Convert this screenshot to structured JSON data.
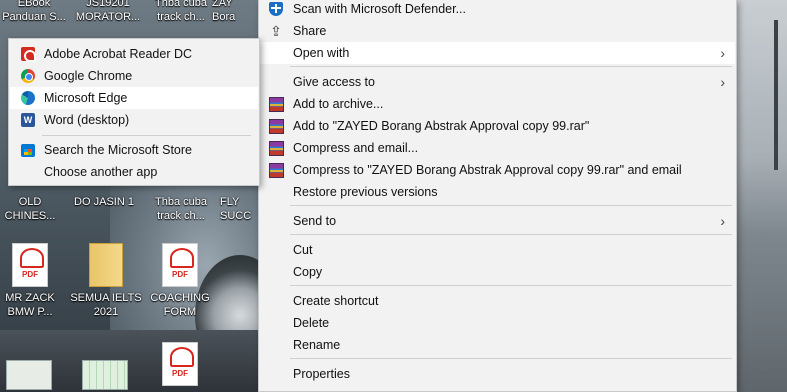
{
  "desktop": {
    "top_labels": [
      "EBook\nPanduan S...",
      "JS19201\nMORATOR...",
      "Thba cuba\ntrack ch...",
      "ZAY\nBora"
    ],
    "mid_labels": [
      "OLD\nCHINES...",
      "DO JASIN 1",
      "Thba cuba\ntrack ch...",
      "FLY\nSUCC"
    ],
    "icons": [
      {
        "label": "MR ZACK\nBMW P...",
        "type": "pdf"
      },
      {
        "label": "SEMUA IELTS\n2021",
        "type": "folder"
      },
      {
        "label": "COACHING\nFORM",
        "type": "pdf"
      },
      {
        "label": "",
        "type": "pdf"
      }
    ],
    "pdf_badge": "PDF"
  },
  "context_menu": {
    "items": [
      {
        "label": "Scan with Microsoft Defender...",
        "icon": "shield-icon"
      },
      {
        "label": "Share",
        "icon": "share-icon"
      },
      {
        "label": "Open with",
        "icon": "",
        "submenu": true,
        "highlighted": true
      },
      {
        "label": "Give access to",
        "icon": "",
        "submenu": true
      },
      {
        "label": "Add to archive...",
        "icon": "winrar-icon"
      },
      {
        "label": "Add to \"ZAYED Borang Abstrak Approval copy 99.rar\"",
        "icon": "winrar-icon"
      },
      {
        "label": "Compress and email...",
        "icon": "winrar-icon"
      },
      {
        "label": "Compress to \"ZAYED Borang Abstrak Approval copy 99.rar\" and email",
        "icon": "winrar-icon"
      },
      {
        "label": "Restore previous versions",
        "icon": ""
      },
      {
        "label": "Send to",
        "icon": "",
        "submenu": true
      },
      {
        "label": "Cut",
        "icon": ""
      },
      {
        "label": "Copy",
        "icon": ""
      },
      {
        "label": "Create shortcut",
        "icon": ""
      },
      {
        "label": "Delete",
        "icon": ""
      },
      {
        "label": "Rename",
        "icon": ""
      },
      {
        "label": "Properties",
        "icon": ""
      }
    ]
  },
  "open_with_menu": {
    "items": [
      {
        "label": "Adobe Acrobat Reader DC",
        "icon": "acrobat-icon"
      },
      {
        "label": "Google Chrome",
        "icon": "chrome-icon"
      },
      {
        "label": "Microsoft Edge",
        "icon": "edge-icon",
        "highlighted": true
      },
      {
        "label": "Word (desktop)",
        "icon": "word-icon"
      },
      {
        "label": "Search the Microsoft Store",
        "icon": "store-icon"
      },
      {
        "label": "Choose another app",
        "icon": ""
      }
    ],
    "word_glyph": "W"
  },
  "colors": {
    "menu_bg": "#f2f2f2",
    "highlight_bg": "#ffffff",
    "defender_blue": "#1a6fc4",
    "acrobat_red": "#d42a1f"
  }
}
